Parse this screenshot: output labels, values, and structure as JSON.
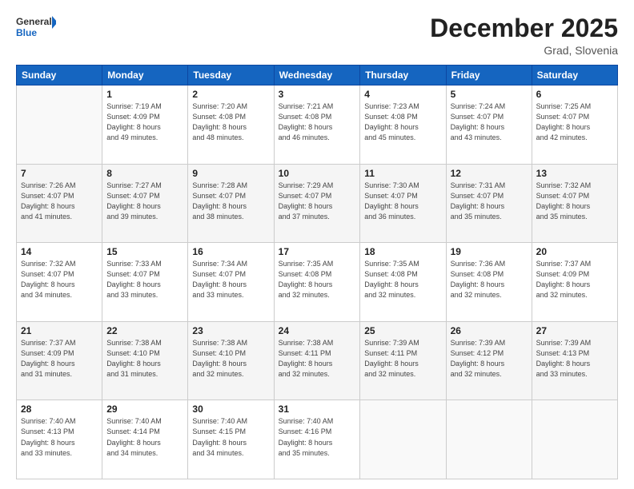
{
  "header": {
    "logo_general": "General",
    "logo_blue": "Blue",
    "month_title": "December 2025",
    "location": "Grad, Slovenia"
  },
  "days_of_week": [
    "Sunday",
    "Monday",
    "Tuesday",
    "Wednesday",
    "Thursday",
    "Friday",
    "Saturday"
  ],
  "weeks": [
    [
      {
        "num": "",
        "info": ""
      },
      {
        "num": "1",
        "info": "Sunrise: 7:19 AM\nSunset: 4:09 PM\nDaylight: 8 hours\nand 49 minutes."
      },
      {
        "num": "2",
        "info": "Sunrise: 7:20 AM\nSunset: 4:08 PM\nDaylight: 8 hours\nand 48 minutes."
      },
      {
        "num": "3",
        "info": "Sunrise: 7:21 AM\nSunset: 4:08 PM\nDaylight: 8 hours\nand 46 minutes."
      },
      {
        "num": "4",
        "info": "Sunrise: 7:23 AM\nSunset: 4:08 PM\nDaylight: 8 hours\nand 45 minutes."
      },
      {
        "num": "5",
        "info": "Sunrise: 7:24 AM\nSunset: 4:07 PM\nDaylight: 8 hours\nand 43 minutes."
      },
      {
        "num": "6",
        "info": "Sunrise: 7:25 AM\nSunset: 4:07 PM\nDaylight: 8 hours\nand 42 minutes."
      }
    ],
    [
      {
        "num": "7",
        "info": "Sunrise: 7:26 AM\nSunset: 4:07 PM\nDaylight: 8 hours\nand 41 minutes."
      },
      {
        "num": "8",
        "info": "Sunrise: 7:27 AM\nSunset: 4:07 PM\nDaylight: 8 hours\nand 39 minutes."
      },
      {
        "num": "9",
        "info": "Sunrise: 7:28 AM\nSunset: 4:07 PM\nDaylight: 8 hours\nand 38 minutes."
      },
      {
        "num": "10",
        "info": "Sunrise: 7:29 AM\nSunset: 4:07 PM\nDaylight: 8 hours\nand 37 minutes."
      },
      {
        "num": "11",
        "info": "Sunrise: 7:30 AM\nSunset: 4:07 PM\nDaylight: 8 hours\nand 36 minutes."
      },
      {
        "num": "12",
        "info": "Sunrise: 7:31 AM\nSunset: 4:07 PM\nDaylight: 8 hours\nand 35 minutes."
      },
      {
        "num": "13",
        "info": "Sunrise: 7:32 AM\nSunset: 4:07 PM\nDaylight: 8 hours\nand 35 minutes."
      }
    ],
    [
      {
        "num": "14",
        "info": "Sunrise: 7:32 AM\nSunset: 4:07 PM\nDaylight: 8 hours\nand 34 minutes."
      },
      {
        "num": "15",
        "info": "Sunrise: 7:33 AM\nSunset: 4:07 PM\nDaylight: 8 hours\nand 33 minutes."
      },
      {
        "num": "16",
        "info": "Sunrise: 7:34 AM\nSunset: 4:07 PM\nDaylight: 8 hours\nand 33 minutes."
      },
      {
        "num": "17",
        "info": "Sunrise: 7:35 AM\nSunset: 4:08 PM\nDaylight: 8 hours\nand 32 minutes."
      },
      {
        "num": "18",
        "info": "Sunrise: 7:35 AM\nSunset: 4:08 PM\nDaylight: 8 hours\nand 32 minutes."
      },
      {
        "num": "19",
        "info": "Sunrise: 7:36 AM\nSunset: 4:08 PM\nDaylight: 8 hours\nand 32 minutes."
      },
      {
        "num": "20",
        "info": "Sunrise: 7:37 AM\nSunset: 4:09 PM\nDaylight: 8 hours\nand 32 minutes."
      }
    ],
    [
      {
        "num": "21",
        "info": "Sunrise: 7:37 AM\nSunset: 4:09 PM\nDaylight: 8 hours\nand 31 minutes."
      },
      {
        "num": "22",
        "info": "Sunrise: 7:38 AM\nSunset: 4:10 PM\nDaylight: 8 hours\nand 31 minutes."
      },
      {
        "num": "23",
        "info": "Sunrise: 7:38 AM\nSunset: 4:10 PM\nDaylight: 8 hours\nand 32 minutes."
      },
      {
        "num": "24",
        "info": "Sunrise: 7:38 AM\nSunset: 4:11 PM\nDaylight: 8 hours\nand 32 minutes."
      },
      {
        "num": "25",
        "info": "Sunrise: 7:39 AM\nSunset: 4:11 PM\nDaylight: 8 hours\nand 32 minutes."
      },
      {
        "num": "26",
        "info": "Sunrise: 7:39 AM\nSunset: 4:12 PM\nDaylight: 8 hours\nand 32 minutes."
      },
      {
        "num": "27",
        "info": "Sunrise: 7:39 AM\nSunset: 4:13 PM\nDaylight: 8 hours\nand 33 minutes."
      }
    ],
    [
      {
        "num": "28",
        "info": "Sunrise: 7:40 AM\nSunset: 4:13 PM\nDaylight: 8 hours\nand 33 minutes."
      },
      {
        "num": "29",
        "info": "Sunrise: 7:40 AM\nSunset: 4:14 PM\nDaylight: 8 hours\nand 34 minutes."
      },
      {
        "num": "30",
        "info": "Sunrise: 7:40 AM\nSunset: 4:15 PM\nDaylight: 8 hours\nand 34 minutes."
      },
      {
        "num": "31",
        "info": "Sunrise: 7:40 AM\nSunset: 4:16 PM\nDaylight: 8 hours\nand 35 minutes."
      },
      {
        "num": "",
        "info": ""
      },
      {
        "num": "",
        "info": ""
      },
      {
        "num": "",
        "info": ""
      }
    ]
  ]
}
